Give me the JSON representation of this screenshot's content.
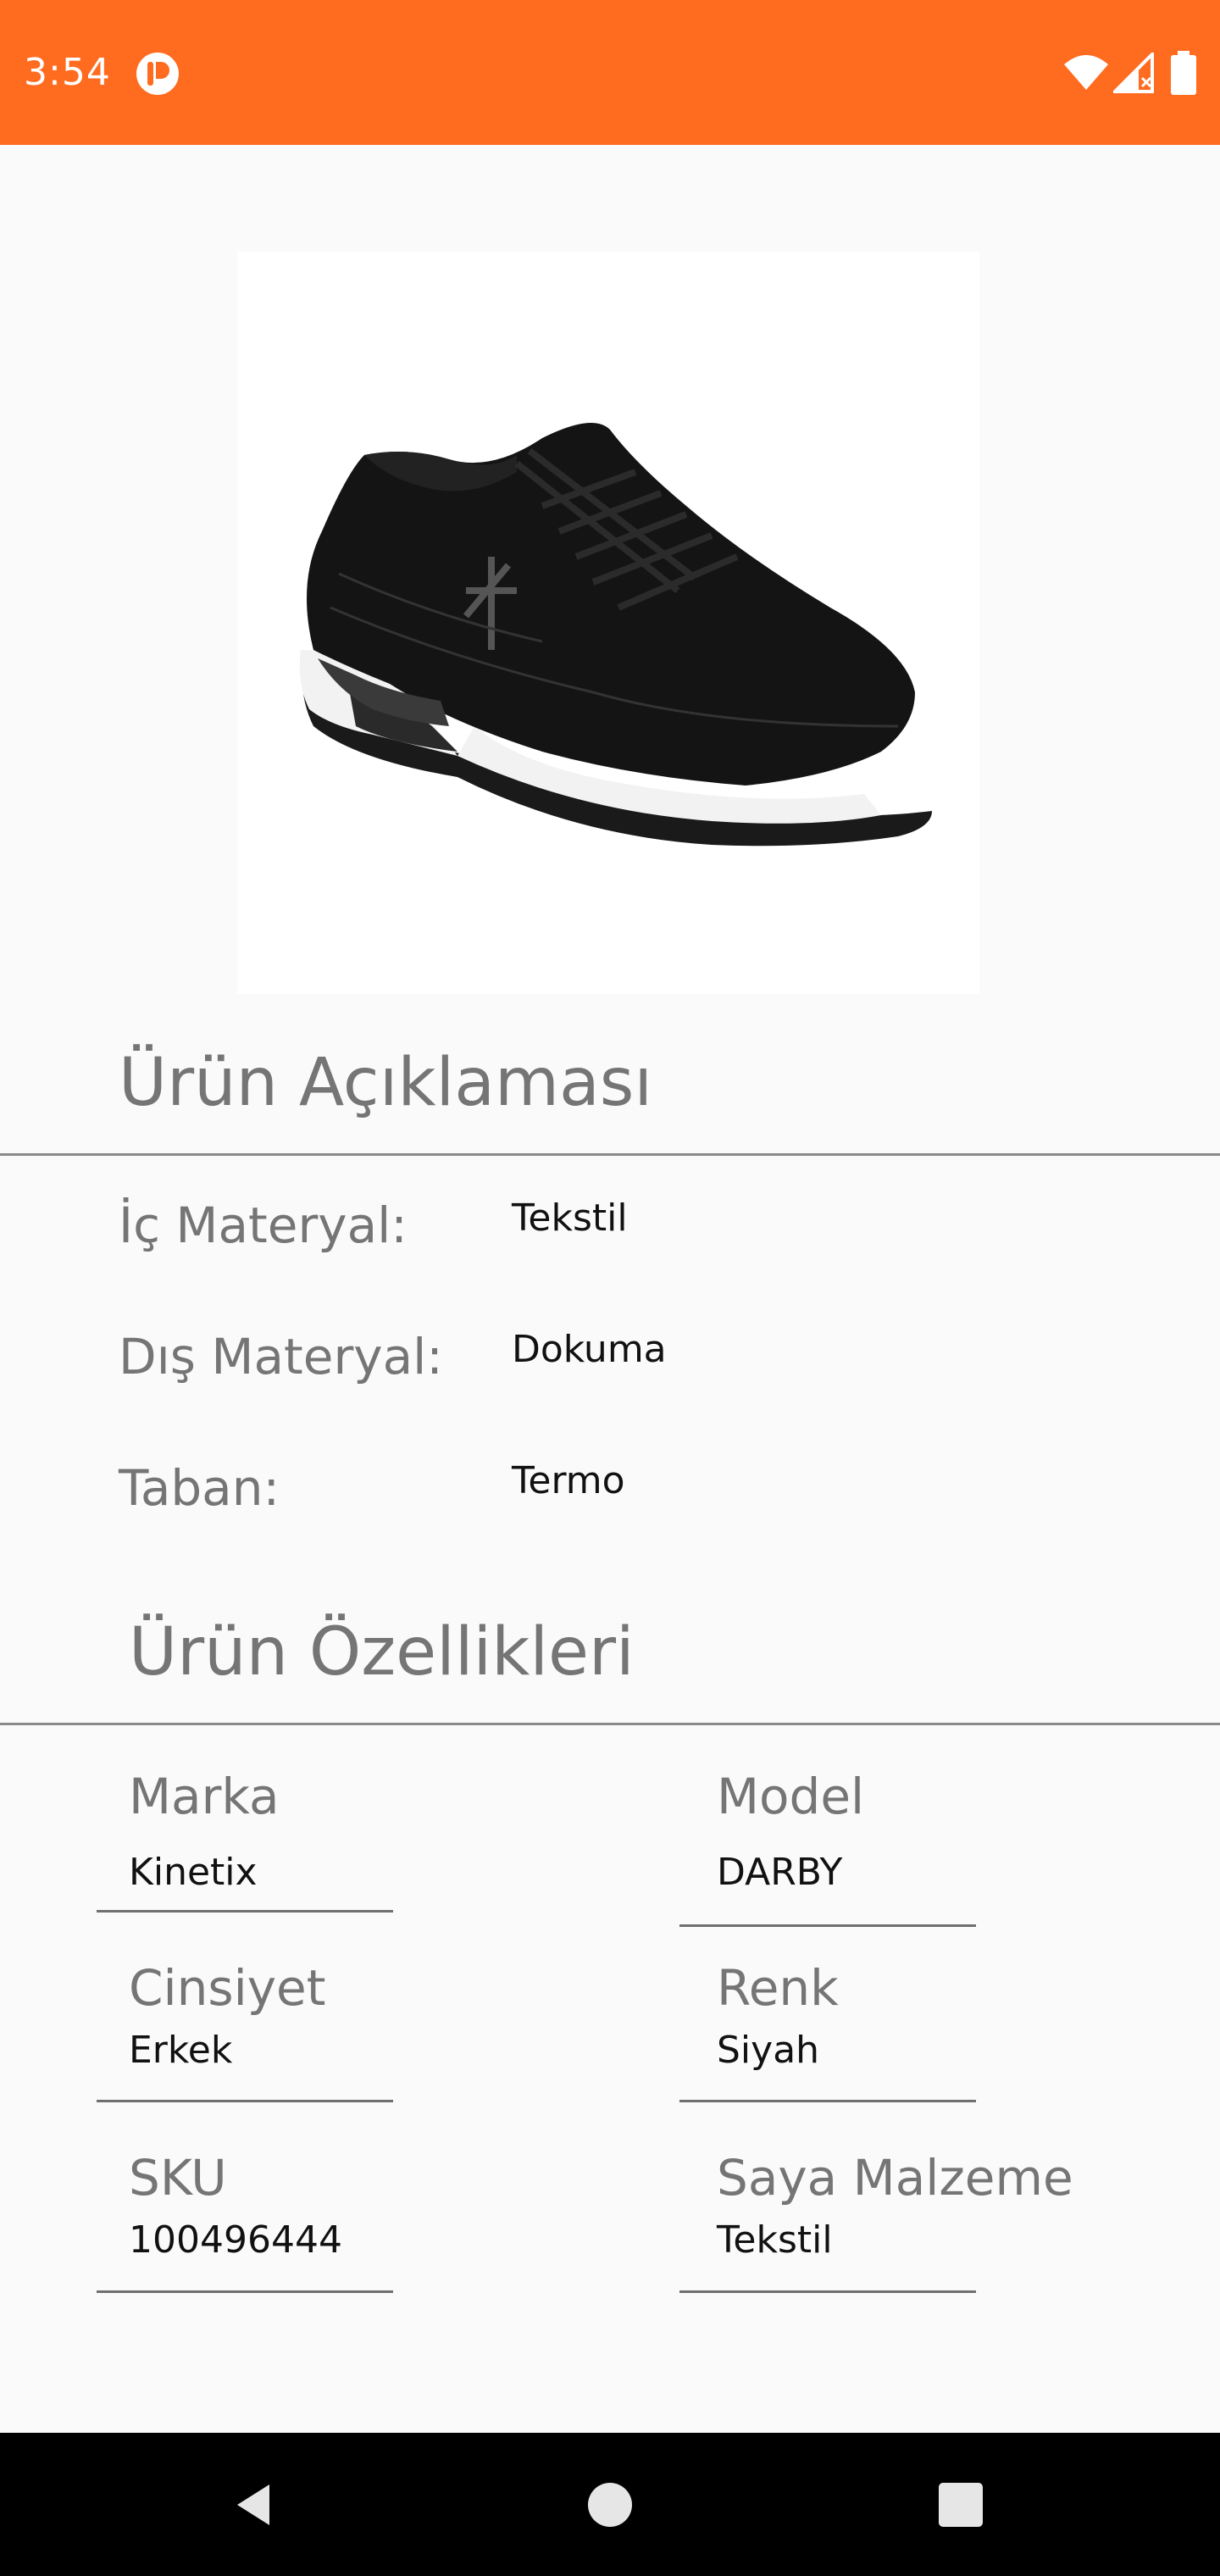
{
  "status_bar": {
    "time": "3:54",
    "app_icon": "app-notification-icon",
    "icons": [
      "wifi-icon",
      "signal-icon",
      "battery-icon"
    ],
    "background_color": "#ff6b1f"
  },
  "product": {
    "image_alt": "Black sneaker with white sole",
    "image_icon": "shoe-product-image"
  },
  "description_section": {
    "title": "Ürün Açıklaması",
    "rows": [
      {
        "label": "İç Materyal:",
        "value": "Tekstil"
      },
      {
        "label": "Dış Materyal:",
        "value": "Dokuma"
      },
      {
        "label": "Taban:",
        "value": "Termo"
      }
    ]
  },
  "features_section": {
    "title": "Ürün Özellikleri",
    "items": [
      {
        "label": "Marka",
        "value": "Kinetix"
      },
      {
        "label": "Model",
        "value": "DARBY"
      },
      {
        "label": "Cinsiyet",
        "value": "Erkek"
      },
      {
        "label": "Renk",
        "value": "Siyah"
      },
      {
        "label": "SKU",
        "value": "100496444"
      },
      {
        "label": "Saya Malzeme",
        "value": "Tekstil"
      }
    ]
  },
  "nav_bar": {
    "buttons": [
      "back-icon",
      "home-icon",
      "recents-icon"
    ]
  }
}
